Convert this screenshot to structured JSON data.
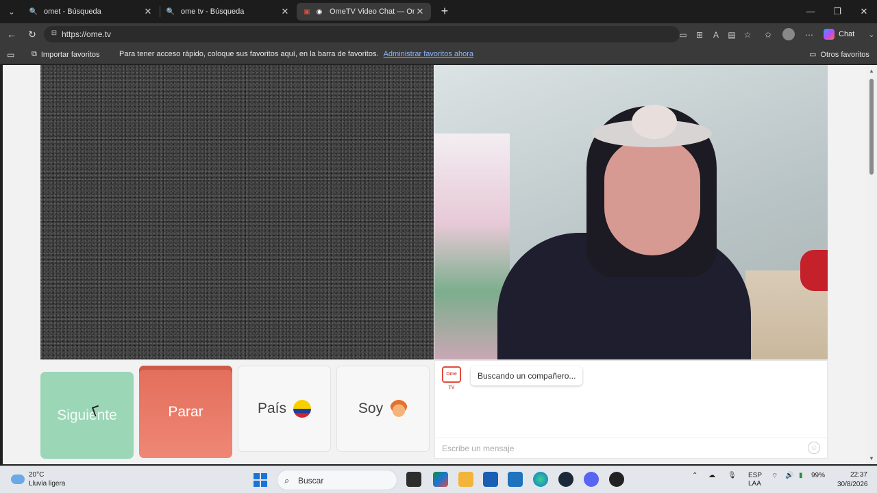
{
  "browser": {
    "tabs": [
      {
        "title": "omet - Búsqueda",
        "active": false
      },
      {
        "title": "ome tv - Búsqueda",
        "active": false
      },
      {
        "title": "OmeTV Video Chat — Omegl",
        "active": true
      }
    ],
    "url": "https://ome.tv",
    "copilot_label": "Chat"
  },
  "favorites_bar": {
    "import_label": "Importar favoritos",
    "message": "Para tener acceso rápido, coloque sus favoritos aquí, en la barra de favoritos.",
    "manage_link": "Administrar favoritos ahora",
    "other_label": "Otros favoritos"
  },
  "page": {
    "buttons": {
      "next": "Siguiente",
      "stop": "Parar",
      "country": "País",
      "gender": "Soy"
    },
    "chat": {
      "logo_text": "Ome TV",
      "status": "Buscando un compañero...",
      "input_placeholder": "Escribe un mensaje"
    }
  },
  "taskbar": {
    "temperature": "20°C",
    "weather": "Lluvia ligera",
    "search_label": "Buscar",
    "language_top": "ESP",
    "language_bottom": "LAA",
    "battery": "99%",
    "time": "22:37",
    "date": "30/8/2026"
  },
  "colors": {
    "next_button": "#9bd7b7",
    "stop_button": "#e56b57",
    "chat_logo": "#e14c3c"
  }
}
